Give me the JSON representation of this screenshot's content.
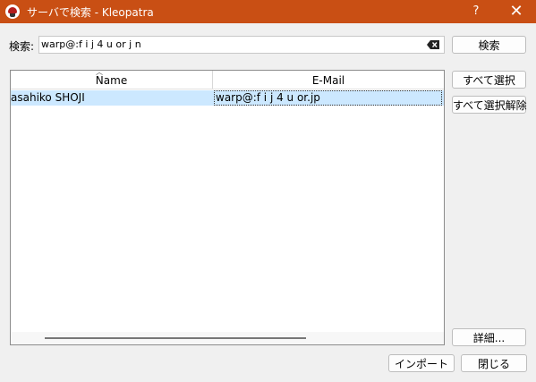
{
  "window": {
    "title": "サーバで検索 - Kleopatra",
    "help": "?",
    "close": "✕"
  },
  "search": {
    "label": "検索:",
    "value": "warp@:f i j 4 u or j n",
    "button": "検索"
  },
  "table": {
    "columns": [
      "Name",
      "E-Mail"
    ],
    "rows": [
      {
        "name": "asahiko SHOJI",
        "email": "warp@:f i j 4 u or.jp"
      }
    ]
  },
  "buttons": {
    "select_all": "すべて選択",
    "deselect_all": "すべて選択解除",
    "details": "詳細...",
    "import": "インポート",
    "close": "閉じる"
  }
}
